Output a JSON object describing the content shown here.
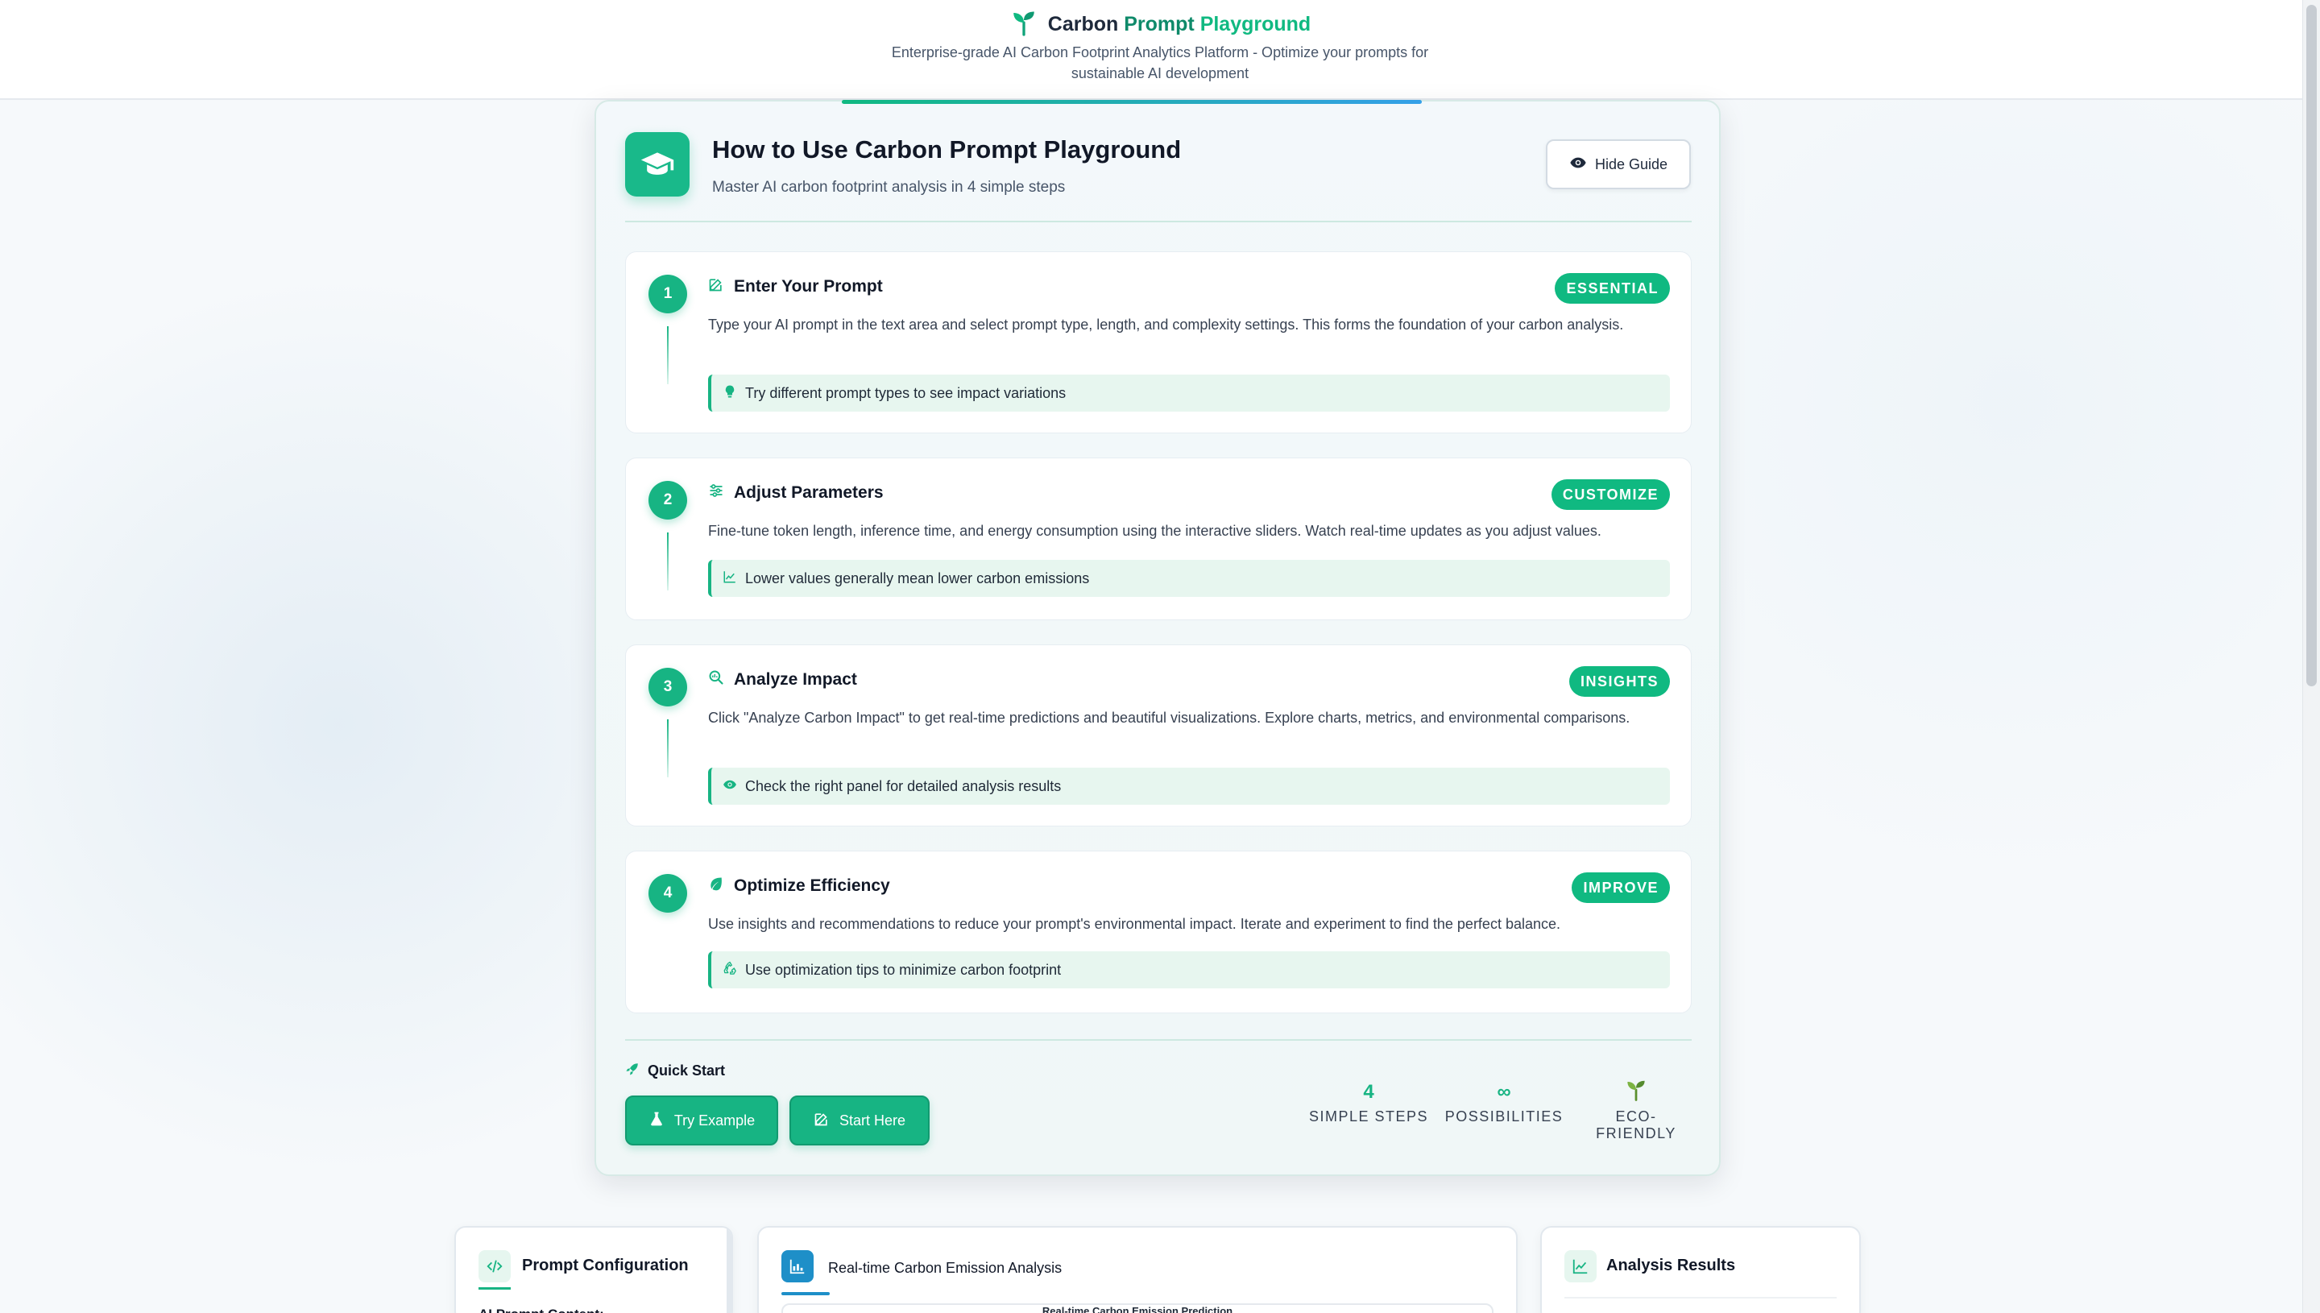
{
  "header": {
    "title_part1": "Carbon",
    "title_part2": "Prompt",
    "title_part3": "Playground",
    "subtitle": "Enterprise-grade AI Carbon Footprint Analytics Platform - Optimize your prompts for sustainable AI development"
  },
  "guide": {
    "title": "How to Use Carbon Prompt Playground",
    "subtitle": "Master AI carbon footprint analysis in 4 simple steps",
    "hide_button": "Hide Guide",
    "steps": [
      {
        "number": "1",
        "icon": "edit-icon",
        "title": "Enter Your Prompt",
        "badge": "ESSENTIAL",
        "description": "Type your AI prompt in the text area and select prompt type, length, and complexity settings. This forms the foundation of your carbon analysis.",
        "tip_icon": "lightbulb-icon",
        "tip": "Try different prompt types to see impact variations"
      },
      {
        "number": "2",
        "icon": "sliders-icon",
        "title": "Adjust Parameters",
        "badge": "CUSTOMIZE",
        "description": "Fine-tune token length, inference time, and energy consumption using the interactive sliders. Watch real-time updates as you adjust values.",
        "tip_icon": "chart-line-icon",
        "tip": "Lower values generally mean lower carbon emissions"
      },
      {
        "number": "3",
        "icon": "search-chart-icon",
        "title": "Analyze Impact",
        "badge": "INSIGHTS",
        "description": "Click \"Analyze Carbon Impact\" to get real-time predictions and beautiful visualizations. Explore charts, metrics, and environmental comparisons.",
        "tip_icon": "eye-icon",
        "tip": "Check the right panel for detailed analysis results"
      },
      {
        "number": "4",
        "icon": "leaf-icon",
        "title": "Optimize Efficiency",
        "badge": "IMPROVE",
        "description": "Use insights and recommendations to reduce your prompt's environmental impact. Iterate and experiment to find the perfect balance.",
        "tip_icon": "recycle-icon",
        "tip": "Use optimization tips to minimize carbon footprint"
      }
    ],
    "quick_start": {
      "label": "Quick Start",
      "try_example": "Try Example",
      "start_here": "Start Here"
    },
    "stats": [
      {
        "value": "4",
        "label": "SIMPLE STEPS"
      },
      {
        "value": "∞",
        "label": "POSSIBILITIES"
      },
      {
        "value": "",
        "icon": "seedling-icon",
        "label": "ECO-FRIENDLY"
      }
    ]
  },
  "panels": {
    "config": {
      "title": "Prompt Configuration",
      "field_label": "AI Prompt Content:"
    },
    "chart": {
      "title": "Real-time Carbon Emission Analysis",
      "chart_title": "Real-time Carbon Emission Prediction"
    },
    "results": {
      "title": "Analysis Results"
    }
  },
  "colors": {
    "accent": "#10b981",
    "accent_dark": "#17b483",
    "tip_bg": "#e7f6ef",
    "chart_icon_bg": "#1e8fc8"
  }
}
